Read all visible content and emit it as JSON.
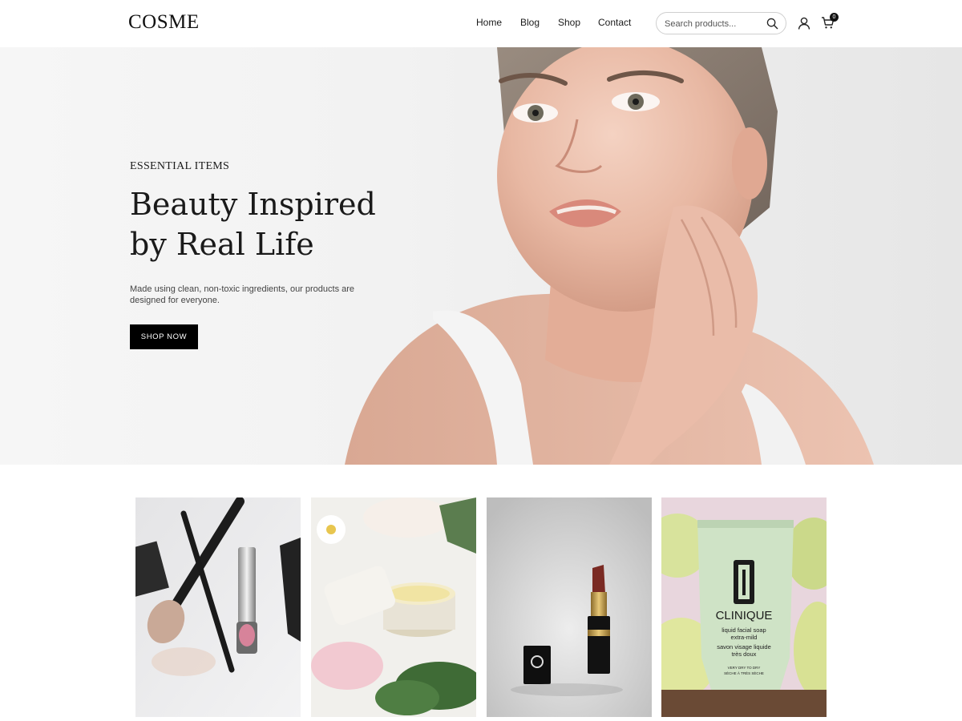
{
  "brand": {
    "logo": "COSME"
  },
  "nav": {
    "home": "Home",
    "blog": "Blog",
    "shop": "Shop",
    "contact": "Contact"
  },
  "search": {
    "placeholder": "Search products..."
  },
  "cart": {
    "count": "0"
  },
  "icons": {
    "search": "search-icon",
    "user": "user-icon",
    "cart": "cart-icon"
  },
  "hero": {
    "eyebrow": "ESSENTIAL ITEMS",
    "title_line1": "Beauty Inspired",
    "title_line2": "by Real Life",
    "description": "Made using clean, non-toxic ingredients, our products are designed for everyone.",
    "cta": "SHOP NOW"
  },
  "tiles": {
    "tube_brand": "CLINIQUE",
    "tube_line1": "liquid facial soap",
    "tube_line2": "extra-mild",
    "tube_line3": "savon visage liquide",
    "tube_line4": "très doux",
    "tube_line5": "VERY DRY TO DRY",
    "tube_line6": "SÈCHE À TRÈS SÈCHE"
  },
  "colors": {
    "accent": "#000000",
    "background": "#ffffff",
    "hero_bg": "#f2f2f2"
  }
}
